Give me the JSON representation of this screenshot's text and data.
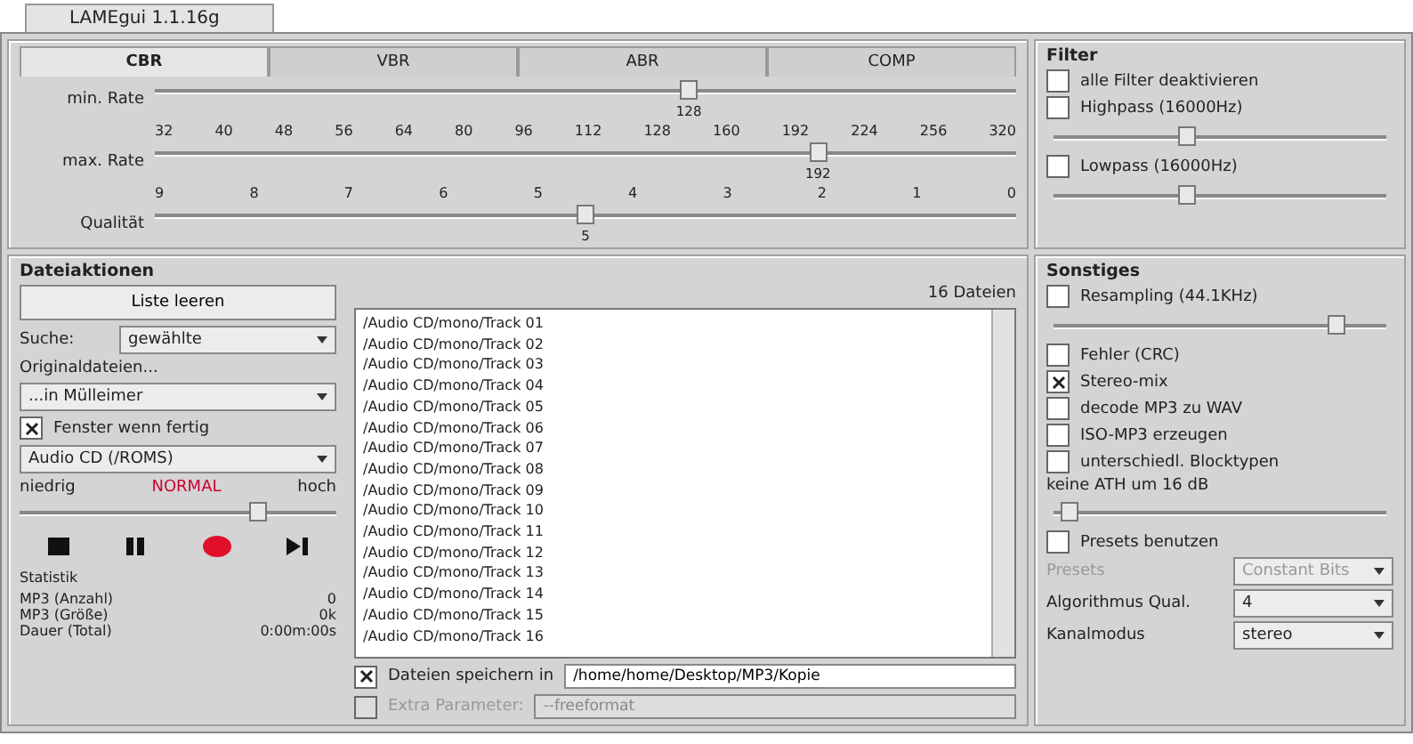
{
  "window": {
    "title": "LAMEgui 1.1.16g"
  },
  "mode_tabs": [
    {
      "label": "CBR",
      "selected": true
    },
    {
      "label": "VBR",
      "selected": false
    },
    {
      "label": "ABR",
      "selected": false
    },
    {
      "label": "COMP",
      "selected": false
    }
  ],
  "rates": {
    "scale": [
      "32",
      "40",
      "48",
      "56",
      "64",
      "80",
      "96",
      "112",
      "128",
      "160",
      "192",
      "224",
      "256",
      "320"
    ],
    "min": {
      "label": "min. Rate",
      "level": 0.62,
      "value": "128"
    },
    "max": {
      "label": "max. Rate",
      "level": 0.77,
      "value": "192"
    },
    "quality_scale": [
      "9",
      "8",
      "7",
      "6",
      "5",
      "4",
      "3",
      "2",
      "1",
      "0"
    ],
    "quality": {
      "label": "Qualität",
      "level": 0.5,
      "value": "5"
    }
  },
  "filter": {
    "title": "Filter",
    "items": [
      {
        "kind": "checkbox",
        "label": "alle Filter deaktivieren",
        "checked": false
      },
      {
        "kind": "checkbox",
        "label": "Highpass (16000Hz)",
        "checked": false
      },
      {
        "kind": "slider",
        "level": 0.4
      },
      {
        "kind": "checkbox",
        "label": "Lowpass (16000Hz)",
        "checked": false
      },
      {
        "kind": "slider",
        "level": 0.4
      }
    ]
  },
  "file_actions": {
    "title": "Dateiaktionen",
    "clear_button": "Liste leeren",
    "search_label": "Suche:",
    "search_value": "gewählte",
    "originals_label": "Originaldateien...",
    "originals_value": "...in Mülleimer",
    "close_checkbox": {
      "label": "Fenster wenn fertig",
      "checked": true
    },
    "source_value": "Audio CD (/ROMS)",
    "priority": {
      "low": "niedrig",
      "mid": "NORMAL",
      "high": "hoch",
      "level": 0.75
    },
    "stats": {
      "title": "Statistik",
      "rows": [
        {
          "label": "MP3 (Anzahl)",
          "value": "0"
        },
        {
          "label": "MP3 (Größe)",
          "value": "0k"
        },
        {
          "label": "Dauer (Total)",
          "value": "0:00m:00s"
        }
      ]
    },
    "count": "16 Dateien",
    "files": [
      "/Audio CD/mono/Track 01",
      "/Audio CD/mono/Track 02",
      "/Audio CD/mono/Track 03",
      "/Audio CD/mono/Track 04",
      "/Audio CD/mono/Track 05",
      "/Audio CD/mono/Track 06",
      "/Audio CD/mono/Track 07",
      "/Audio CD/mono/Track 08",
      "/Audio CD/mono/Track 09",
      "/Audio CD/mono/Track 10",
      "/Audio CD/mono/Track 11",
      "/Audio CD/mono/Track 12",
      "/Audio CD/mono/Track 13",
      "/Audio CD/mono/Track 14",
      "/Audio CD/mono/Track 15",
      "/Audio CD/mono/Track 16"
    ],
    "save": {
      "label": "Dateien speichern in",
      "checked": true,
      "path": "/home/home/Desktop/MP3/Kopie"
    },
    "extra": {
      "label": "Extra Parameter:",
      "checked": false,
      "disabled": true,
      "placeholder": "--freeformat"
    }
  },
  "misc": {
    "title": "Sonstiges",
    "items": [
      {
        "kind": "checkbox",
        "label": "Resampling (44.1KHz)",
        "checked": false
      },
      {
        "kind": "slider",
        "level": 0.85
      },
      {
        "kind": "checkbox",
        "label": "Fehler (CRC)",
        "checked": false
      },
      {
        "kind": "checkbox",
        "label": "Stereo-mix",
        "checked": true
      },
      {
        "kind": "checkbox",
        "label": "decode MP3 zu WAV",
        "checked": false
      },
      {
        "kind": "checkbox",
        "label": "ISO-MP3 erzeugen",
        "checked": false
      },
      {
        "kind": "checkbox",
        "label": "unterschiedl. Blocktypen",
        "checked": false
      },
      {
        "kind": "text",
        "label": "keine ATH um 16 dB"
      },
      {
        "kind": "slider",
        "level": 0.05
      },
      {
        "kind": "checkbox",
        "label": "Presets benutzen",
        "checked": false
      },
      {
        "kind": "select",
        "label": "Presets",
        "value": "Constant Bits",
        "disabled": true
      },
      {
        "kind": "select",
        "label": "Algorithmus Qual.",
        "value": "4",
        "disabled": false
      },
      {
        "kind": "select",
        "label": "Kanalmodus",
        "value": "stereo",
        "disabled": false
      }
    ]
  }
}
